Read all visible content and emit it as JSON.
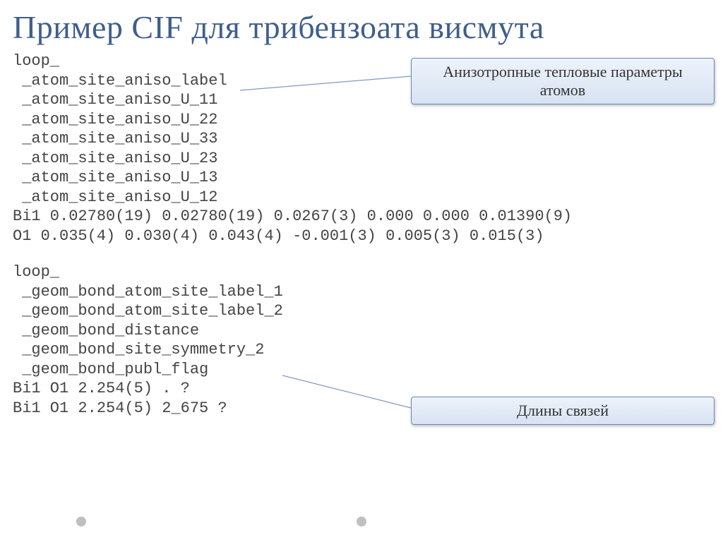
{
  "title": "Пример CIF для трибензоата висмута",
  "block1": {
    "lines": [
      "loop_",
      " _atom_site_aniso_label",
      " _atom_site_aniso_U_11",
      " _atom_site_aniso_U_22",
      " _atom_site_aniso_U_33",
      " _atom_site_aniso_U_23",
      " _atom_site_aniso_U_13",
      " _atom_site_aniso_U_12",
      "Bi1 0.02780(19) 0.02780(19) 0.0267(3) 0.000 0.000 0.01390(9)",
      "O1 0.035(4) 0.030(4) 0.043(4) -0.001(3) 0.005(3) 0.015(3)"
    ]
  },
  "block2": {
    "lines": [
      "loop_",
      " _geom_bond_atom_site_label_1",
      " _geom_bond_atom_site_label_2",
      " _geom_bond_distance",
      " _geom_bond_site_symmetry_2",
      " _geom_bond_publ_flag",
      "Bi1 O1 2.254(5) . ?",
      "Bi1 O1 2.254(5) 2_675 ?"
    ]
  },
  "callouts": {
    "aniso": "Анизотропные тепловые параметры атомов",
    "bonds": "Длины связей"
  }
}
